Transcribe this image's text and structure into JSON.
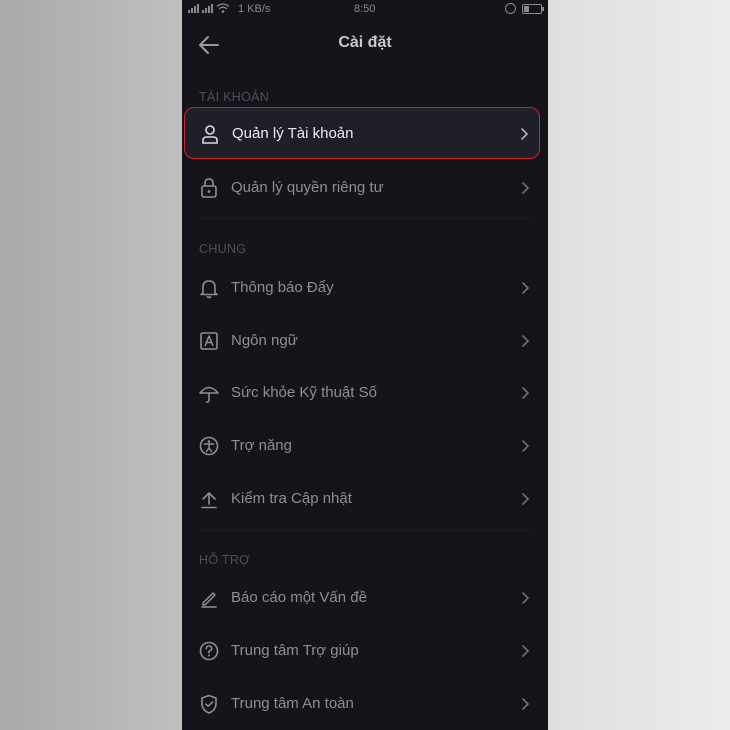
{
  "status_bar": {
    "network_speed": "1 KB/s",
    "time": "8:50"
  },
  "header": {
    "title": "Cài đặt",
    "back_icon": "arrow-left-icon"
  },
  "sections": [
    {
      "label": "TÀI KHOẢN",
      "items": [
        {
          "label": "Quản lý Tài khoản",
          "icon": "person-icon",
          "highlighted": true
        },
        {
          "label": "Quản lý quyền riêng tư",
          "icon": "lock-icon"
        }
      ]
    },
    {
      "label": "CHUNG",
      "items": [
        {
          "label": "Thông báo Đẩy",
          "icon": "bell-icon"
        },
        {
          "label": "Ngôn ngữ",
          "icon": "language-icon"
        },
        {
          "label": "Sức khỏe Kỹ thuật Số",
          "icon": "umbrella-icon"
        },
        {
          "label": "Trợ năng",
          "icon": "accessibility-icon"
        },
        {
          "label": "Kiểm tra Cập nhật",
          "icon": "upload-icon"
        }
      ]
    },
    {
      "label": "HỖ TRỢ",
      "items": [
        {
          "label": "Báo cáo một Vấn đề",
          "icon": "pencil-icon"
        },
        {
          "label": "Trung tâm Trợ giúp",
          "icon": "help-icon"
        },
        {
          "label": "Trung tâm An toàn",
          "icon": "shield-icon"
        }
      ]
    }
  ],
  "colors": {
    "background": "#14141a",
    "highlight_border": "#d2232a",
    "text": "#8e8e94",
    "section_label": "#4f4f57"
  }
}
